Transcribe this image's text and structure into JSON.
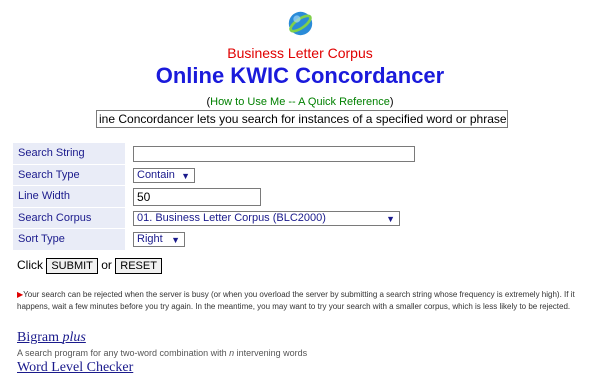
{
  "header": {
    "subtitle": "Business Letter Corpus",
    "title": "Online KWIC Concordancer",
    "howto_open": "(",
    "howto_link": "How to Use Me -- A Quick Reference",
    "howto_close": ")",
    "marquee_text": "ine Concordancer lets you search for instances of a specified word or phrase through"
  },
  "form": {
    "rows": [
      {
        "label": "Search String",
        "value": ""
      },
      {
        "label": "Search Type",
        "value": "Contain"
      },
      {
        "label": "Line Width",
        "value": "50"
      },
      {
        "label": "Search Corpus",
        "value": "01. Business Letter Corpus (BLC2000)"
      },
      {
        "label": "Sort Type",
        "value": "Right"
      }
    ],
    "click_label": "Click",
    "submit_label": "SUBMIT",
    "or_label": "or",
    "reset_label": "RESET"
  },
  "notice": {
    "marker": "▶",
    "text": "Your search can be rejected when the server is busy (or when you overload the server by submitting a search string whose frequency is extremely high). If it happens, wait a few minutes before you try again. In the meantime, you may want to try your search with a smaller corpus, which is less likely to be rejected."
  },
  "tools": {
    "bigram_title": "Bigram",
    "bigram_suffix": "plus",
    "bigram_desc_pre": "A search program for any two-word combination with",
    "bigram_desc_n": "n",
    "bigram_desc_post": "intervening words",
    "wlc_title": "Word Level Checker"
  },
  "icons": {
    "globe": "globe-icon",
    "arrow": "chevron-down-icon"
  }
}
